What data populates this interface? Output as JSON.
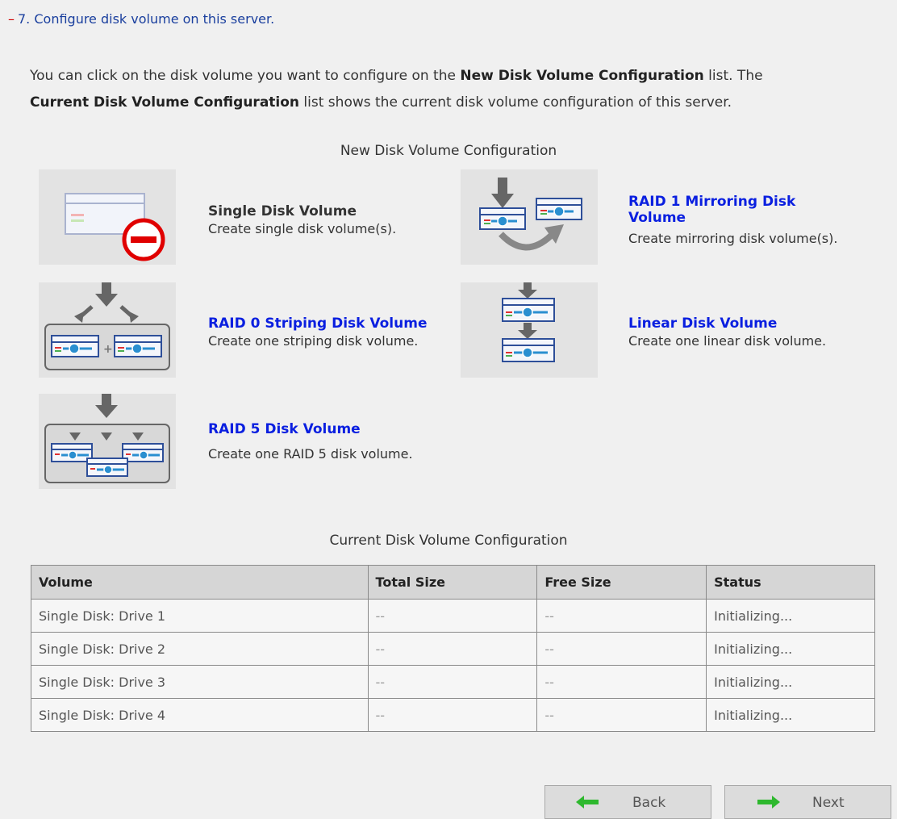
{
  "step": {
    "marker": "–",
    "title": "7. Configure disk volume on this server."
  },
  "intro": {
    "part1": "You can click on the disk volume you want to configure on the ",
    "bold1": "New Disk Volume Configuration",
    "part2": " list. The ",
    "bold2": "Current Disk Volume Configuration",
    "part3": " list shows the current disk volume configuration of this server."
  },
  "new_config": {
    "title": "New Disk Volume Configuration",
    "options": [
      {
        "title": "Single Disk Volume",
        "desc": "Create single disk volume(s).",
        "enabled": false,
        "icon": "single-disk-disabled-icon"
      },
      {
        "title": "RAID 1 Mirroring Disk Volume",
        "desc": "Create mirroring disk volume(s).",
        "enabled": true,
        "icon": "raid1-mirroring-icon"
      },
      {
        "title": "RAID 0 Striping Disk Volume",
        "desc": "Create one striping disk volume.",
        "enabled": true,
        "icon": "raid0-striping-icon"
      },
      {
        "title": "Linear Disk Volume",
        "desc": "Create one linear disk volume.",
        "enabled": true,
        "icon": "linear-disk-icon"
      },
      {
        "title": "RAID 5 Disk Volume",
        "desc": "Create one RAID 5 disk volume.",
        "enabled": true,
        "icon": "raid5-disk-icon"
      }
    ]
  },
  "current_config": {
    "title": "Current Disk Volume Configuration",
    "columns": [
      "Volume",
      "Total Size",
      "Free Size",
      "Status"
    ],
    "rows": [
      [
        "Single Disk: Drive 1",
        "--",
        "--",
        "Initializing..."
      ],
      [
        "Single Disk: Drive 2",
        "--",
        "--",
        "Initializing..."
      ],
      [
        "Single Disk: Drive 3",
        "--",
        "--",
        "Initializing..."
      ],
      [
        "Single Disk: Drive 4",
        "--",
        "--",
        "Initializing..."
      ]
    ]
  },
  "buttons": {
    "back": "Back",
    "next": "Next"
  },
  "colors": {
    "link": "#0a1fe0",
    "step_title": "#1a3f9e",
    "arrow_green": "#2eb82e"
  }
}
